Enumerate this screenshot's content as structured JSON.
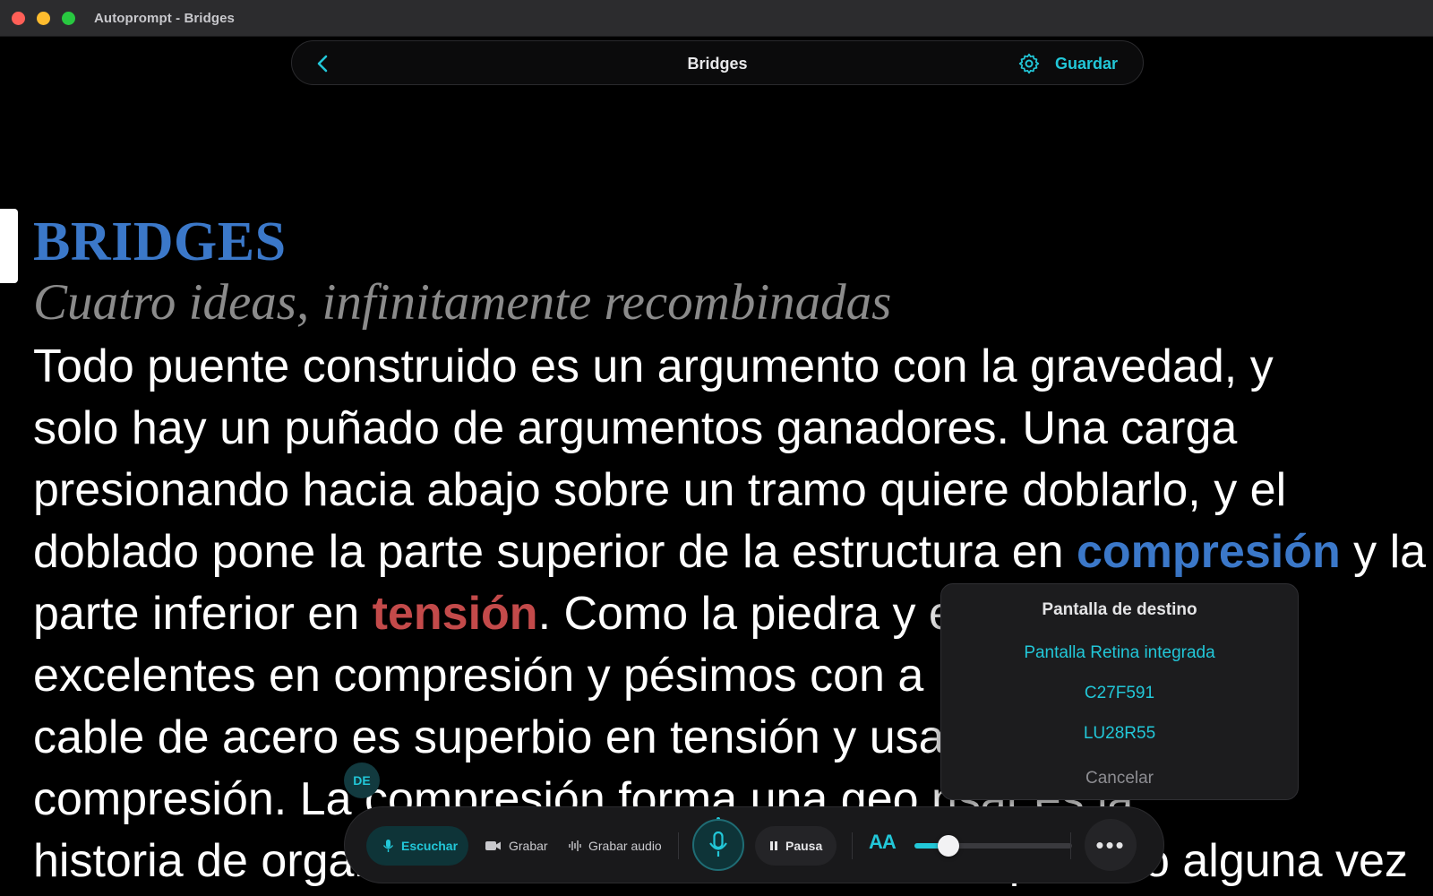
{
  "window": {
    "title": "Autoprompt - Bridges",
    "controls": [
      "close",
      "minimize",
      "zoom"
    ]
  },
  "navbar": {
    "back_icon": "chevron-left-icon",
    "title": "Bridges",
    "settings_icon": "gear-icon",
    "save_label": "Guardar",
    "accent_color": "#22c7d8"
  },
  "document": {
    "heading": "BRIDGES",
    "subtitle": "Cuatro ideas, infinitamente recombinadas",
    "lines": [
      {
        "text": "Todo puente construido es un argumento con la gravedad, y"
      },
      {
        "text": "solo hay un puñado de argumentos ganadores. Una carga"
      },
      {
        "text": "presionando hacia abajo sobre un tramo quiere doblarlo, y el"
      },
      {
        "pre": "doblado pone la parte superior de la estructura en ",
        "highlight": "compresión",
        "post": " y la"
      },
      {
        "pre": "parte inferior en ",
        "highlight": "tensión",
        "post": ". Como la piedra y e"
      },
      {
        "text": "excelentes en compresión y pésimos con a"
      },
      {
        "text": "cable de acero es superbio en tensión y usa"
      },
      {
        "text": "compresión. La compresión forma una geo          nsar es la"
      },
      {
        "text": "historia de organizar materiales de tal manera que solo alguna vez"
      }
    ],
    "highlight_colors": {
      "compresion": "#3b78c9",
      "tension": "#c34a4a"
    }
  },
  "screen_menu": {
    "title": "Pantalla de destino",
    "options": [
      "Pantalla Retina integrada",
      "C27F591",
      "LU28R55"
    ],
    "cancel": "Cancelar"
  },
  "language_badge": "DE",
  "controls": {
    "listen": "Escuchar",
    "record": "Grabar",
    "record_audio": "Grabar audio",
    "pause": "Pausa",
    "font_size_label": "AA",
    "font_size_level": 0.18,
    "more_icon": "ellipsis-icon"
  }
}
